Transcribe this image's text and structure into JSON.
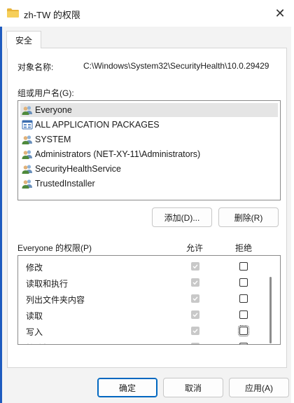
{
  "window": {
    "title": "zh-TW 的权限",
    "close_glyph": "✕"
  },
  "tabs": [
    {
      "label": "安全"
    }
  ],
  "object": {
    "label": "对象名称:",
    "path": "C:\\Windows\\System32\\SecurityHealth\\10.0.29429"
  },
  "groups": {
    "label": "组或用户名(G):",
    "items": [
      {
        "name": "Everyone",
        "icon": "group-users-icon",
        "selected": true
      },
      {
        "name": "ALL APPLICATION PACKAGES",
        "icon": "app-packages-icon",
        "selected": false
      },
      {
        "name": "SYSTEM",
        "icon": "group-users-icon",
        "selected": false
      },
      {
        "name": "Administrators (NET-XY-11\\Administrators)",
        "icon": "group-users-icon",
        "selected": false
      },
      {
        "name": "SecurityHealthService",
        "icon": "group-users-icon",
        "selected": false
      },
      {
        "name": "TrustedInstaller",
        "icon": "group-users-icon",
        "selected": false
      }
    ]
  },
  "buttons": {
    "add": "添加(D)...",
    "remove": "删除(R)",
    "ok": "确定",
    "cancel": "取消",
    "apply": "应用(A)"
  },
  "permissions": {
    "header": "Everyone 的权限(P)",
    "allow_header": "允许",
    "deny_header": "拒绝",
    "rows": [
      {
        "name": "修改",
        "allow": true,
        "deny": false
      },
      {
        "name": "读取和执行",
        "allow": true,
        "deny": false
      },
      {
        "name": "列出文件夹内容",
        "allow": true,
        "deny": false
      },
      {
        "name": "读取",
        "allow": true,
        "deny": false
      },
      {
        "name": "写入",
        "allow": true,
        "deny": false
      },
      {
        "name": "特殊权限",
        "allow": false,
        "deny": false
      }
    ]
  },
  "colors": {
    "accent": "#0067c0",
    "window_edge": "#1e5bbf"
  }
}
